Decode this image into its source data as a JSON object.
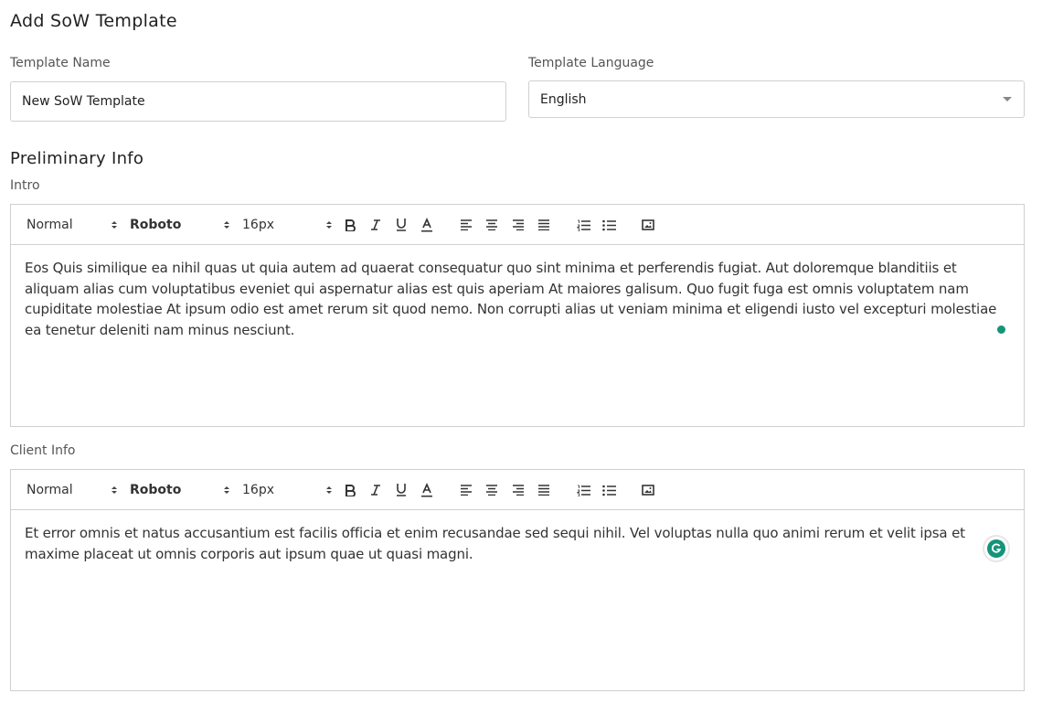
{
  "page": {
    "title": "Add SoW Template"
  },
  "template_name": {
    "label": "Template Name",
    "value": "New SoW Template"
  },
  "template_language": {
    "label": "Template Language",
    "selected": "English"
  },
  "preliminary": {
    "title": "Preliminary Info"
  },
  "editors": [
    {
      "label": "Intro",
      "toolbar": {
        "header": "Normal",
        "font": "Roboto",
        "size": "16px"
      },
      "content": "Eos Quis similique ea nihil quas ut quia autem ad quaerat consequatur quo sint minima et perferendis fugiat. Aut doloremque blanditiis et aliquam alias cum voluptatibus eveniet qui aspernatur alias est quis aperiam At maiores galisum. Quo fugit fuga est omnis voluptatem nam cupiditate molestiae At ipsum odio est amet rerum sit quod nemo. Non corrupti alias ut veniam minima et eligendi iusto vel excepturi molestiae ea tenetur deleniti nam minus nesciunt."
    },
    {
      "label": "Client Info",
      "toolbar": {
        "header": "Normal",
        "font": "Roboto",
        "size": "16px"
      },
      "content": "Et error omnis et natus accusantium est facilis officia et enim recusandae sed sequi nihil. Vel voluptas nulla quo animi rerum et velit ipsa et maxime placeat ut omnis corporis aut ipsum quae ut quasi magni."
    }
  ],
  "icons": [
    "bold-icon",
    "italic-icon",
    "underline-icon",
    "text-color-icon",
    "align-left-icon",
    "align-center-icon",
    "align-right-icon",
    "align-justify-icon",
    "ordered-list-icon",
    "bullet-list-icon",
    "image-icon",
    "grammarly-icon"
  ],
  "colors": {
    "accent": "#15947a",
    "border": "#d0d0d0",
    "text": "#333333"
  }
}
